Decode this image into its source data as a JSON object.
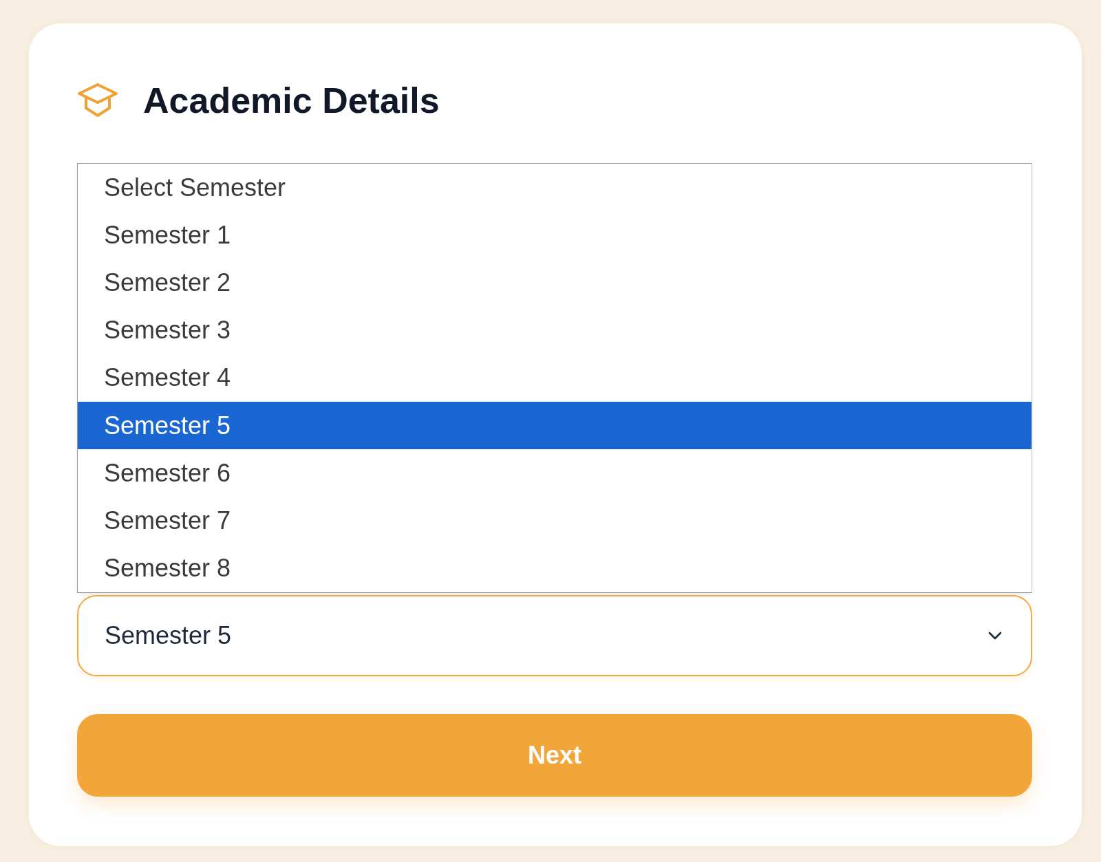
{
  "header": {
    "title": "Academic Details"
  },
  "semester_dropdown": {
    "expanded": true,
    "options": [
      {
        "label": "Select Semester",
        "selected": false
      },
      {
        "label": "Semester 1",
        "selected": false
      },
      {
        "label": "Semester 2",
        "selected": false
      },
      {
        "label": "Semester 3",
        "selected": false
      },
      {
        "label": "Semester 4",
        "selected": false
      },
      {
        "label": "Semester 5",
        "selected": true
      },
      {
        "label": "Semester 6",
        "selected": false
      },
      {
        "label": "Semester 7",
        "selected": false
      },
      {
        "label": "Semester 8",
        "selected": false
      }
    ],
    "value": "Semester 5"
  },
  "buttons": [
    {
      "label": "Next"
    }
  ]
}
